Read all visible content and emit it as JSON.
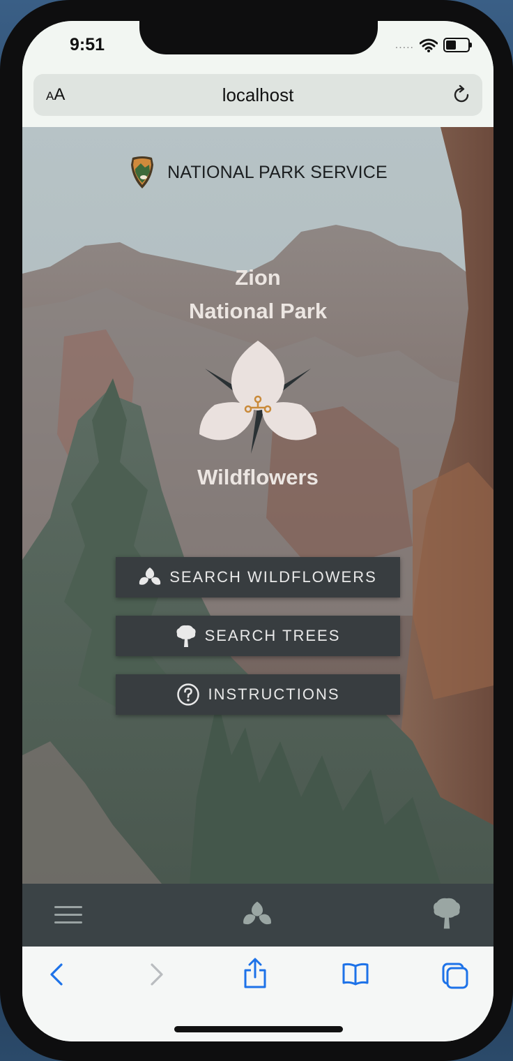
{
  "status_bar": {
    "time": "9:51",
    "signal_dots": "....."
  },
  "browser": {
    "text_size_label_small": "A",
    "text_size_label_large": "A",
    "url": "localhost"
  },
  "hero": {
    "agency": "NATIONAL PARK SERVICE",
    "park_line1": "Zion",
    "park_line2": "National Park",
    "section_title": "Wildflowers"
  },
  "buttons": {
    "search_wildflowers": "SEARCH WILDFLOWERS",
    "search_trees": "SEARCH TREES",
    "instructions": "INSTRUCTIONS"
  },
  "colors": {
    "button_bg": "#383d40",
    "nav_bg": "#3b4346",
    "safari_accent": "#1d72e8",
    "title_text": "#ece6e2"
  },
  "icons": {
    "nav_menu": "hamburger-icon",
    "nav_wildflowers": "flower-icon",
    "nav_trees": "tree-icon",
    "toolbar": [
      "back-chevron-icon",
      "forward-chevron-icon",
      "share-icon",
      "bookmarks-icon",
      "tabs-icon"
    ]
  }
}
